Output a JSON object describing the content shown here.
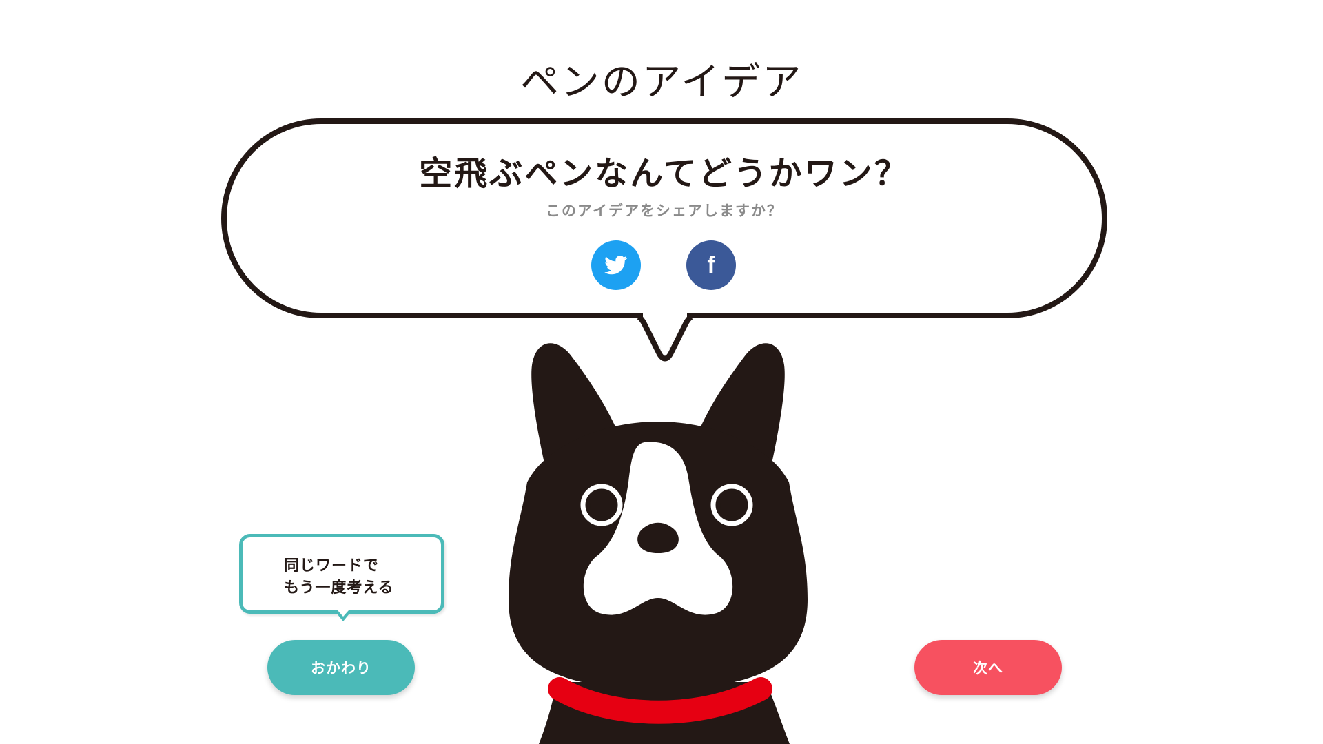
{
  "page": {
    "title": "ペンのアイデア"
  },
  "idea_bubble": {
    "idea_text": "空飛ぶペンなんてどうかワン？",
    "share_prompt": "このアイデアをシェアしますか？",
    "share_buttons": [
      {
        "service": "Twitter",
        "icon": "twitter-bird-icon",
        "color": "#1da1f2"
      },
      {
        "service": "Facebook",
        "icon": "facebook-f-icon",
        "color": "#3b5998",
        "glyph": "f"
      }
    ]
  },
  "hint_bubble": {
    "line1": "同じワードで",
    "line2": "もう一度考える",
    "border_color": "#4bbab8"
  },
  "buttons": {
    "again_label": "おかわり",
    "again_color": "#4bbab8",
    "next_label": "次へ",
    "next_color": "#f75160"
  },
  "mascot": {
    "icon": "boston-terrier-dog-icon",
    "body_color": "#231815",
    "collar_color": "#e60012"
  }
}
